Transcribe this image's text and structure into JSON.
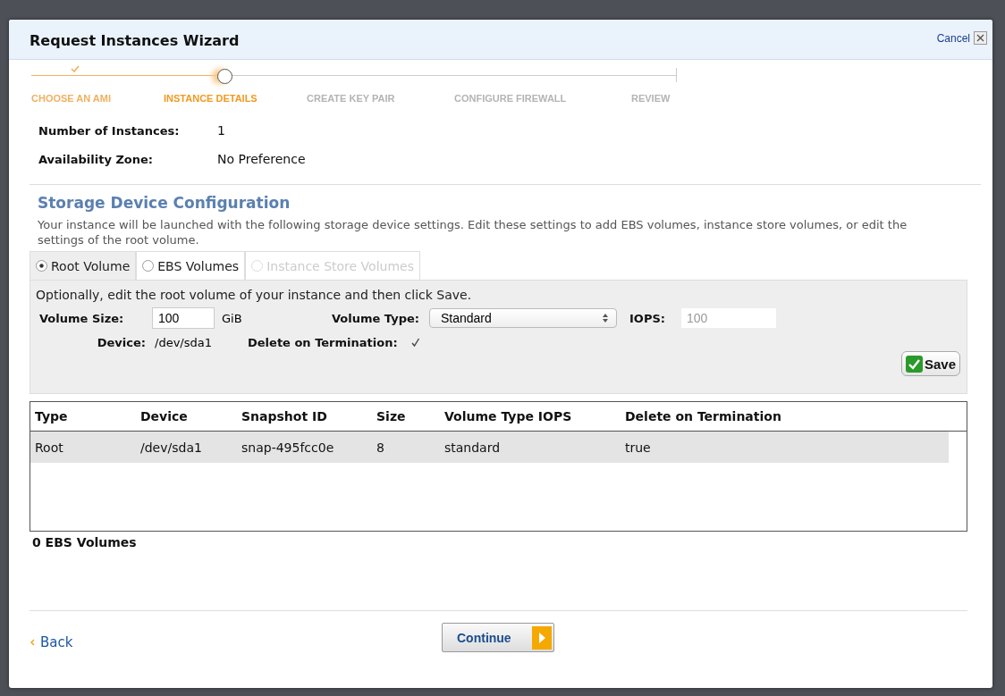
{
  "dialog": {
    "title": "Request Instances Wizard",
    "cancel": "Cancel"
  },
  "steps": [
    {
      "label": "CHOOSE AN AMI",
      "done": true,
      "current": false
    },
    {
      "label": "INSTANCE DETAILS",
      "done": false,
      "current": true
    },
    {
      "label": "CREATE KEY PAIR",
      "done": false,
      "current": false
    },
    {
      "label": "CONFIGURE FIREWALL",
      "done": false,
      "current": false
    },
    {
      "label": "REVIEW",
      "done": false,
      "current": false
    }
  ],
  "details": [
    {
      "label": "Number of Instances:",
      "value": "1"
    },
    {
      "label": "Availability Zone:",
      "value": "No Preference"
    }
  ],
  "storage": {
    "heading": "Storage Device Configuration",
    "description": "Your instance will be launched with the following storage device settings. Edit these settings to add EBS volumes, instance store volumes, or edit the settings of the root volume."
  },
  "tabs": [
    {
      "label": "Root Volume",
      "selected": true,
      "disabled": false
    },
    {
      "label": "EBS Volumes",
      "selected": false,
      "disabled": false
    },
    {
      "label": "Instance Store Volumes",
      "selected": false,
      "disabled": true
    }
  ],
  "panel": {
    "hint": "Optionally, edit the root volume of your instance and then click Save.",
    "volume_size": {
      "label": "Volume Size:",
      "value": "100",
      "unit": "GiB"
    },
    "volume_type": {
      "label": "Volume Type:",
      "value": "Standard"
    },
    "iops": {
      "label": "IOPS:",
      "value": "100",
      "disabled": true
    },
    "device": {
      "label": "Device:",
      "value": "/dev/sda1"
    },
    "delete_on_termination": {
      "label": "Delete on Termination:",
      "checked": true
    },
    "save": "Save"
  },
  "table": {
    "columns": [
      "Type",
      "Device",
      "Snapshot ID",
      "Size",
      "Volume Type IOPS",
      "Delete on Termination"
    ],
    "rows": [
      {
        "selected": true,
        "cells": [
          "Root",
          "/dev/sda1",
          "snap-495fcc0e",
          "8",
          "standard",
          "true"
        ]
      }
    ]
  },
  "ebs_count": "0 EBS Volumes",
  "footer": {
    "back": "Back",
    "continue": "Continue"
  }
}
